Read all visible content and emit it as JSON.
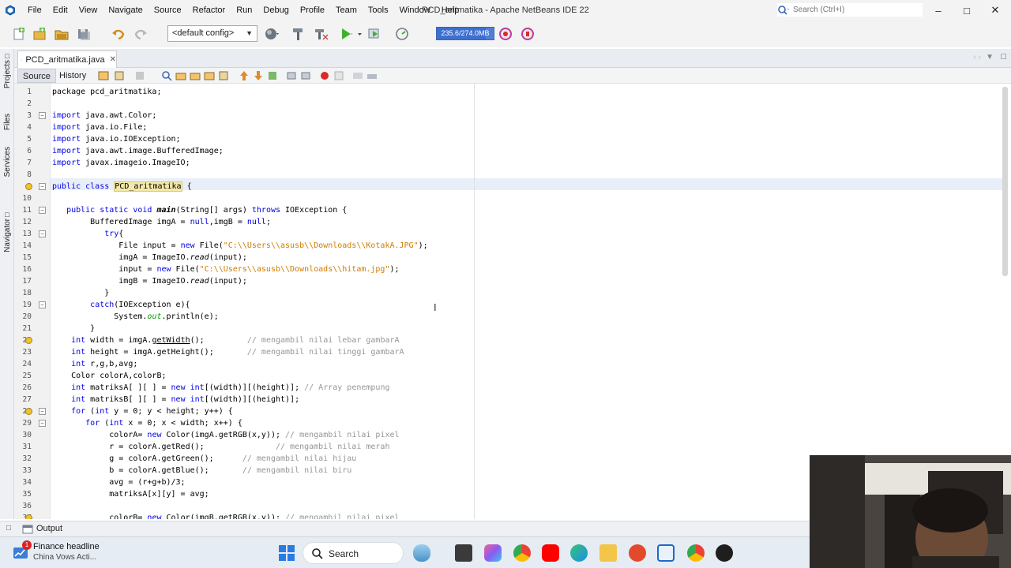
{
  "window": {
    "title": "PCD_aritmatika - Apache NetBeans IDE 22",
    "search_placeholder": "Search (Ctrl+I)"
  },
  "menu": [
    "File",
    "Edit",
    "View",
    "Navigate",
    "Source",
    "Refactor",
    "Run",
    "Debug",
    "Profile",
    "Team",
    "Tools",
    "Window",
    "Help"
  ],
  "toolbar": {
    "config": "<default config>",
    "memory_label": "235.6/274.0MB",
    "memory_fraction": 0.86
  },
  "sidebar": {
    "tabs": [
      "Projects",
      "Files",
      "Services",
      "Navigator"
    ]
  },
  "editor": {
    "file_tab": "PCD_aritmatika.java",
    "source_tab": "Source",
    "history_tab": "History"
  },
  "code_lines": [
    {
      "n": "1",
      "html": "package pcd_aritmatika;"
    },
    {
      "n": "2",
      "html": ""
    },
    {
      "n": "3",
      "html": "<span class='kw'>import</span> java.awt.Color;"
    },
    {
      "n": "4",
      "html": "<span class='kw'>import</span> java.io.File;"
    },
    {
      "n": "5",
      "html": "<span class='kw'>import</span> java.io.IOException;"
    },
    {
      "n": "6",
      "html": "<span class='kw'>import</span> java.awt.image.BufferedImage;"
    },
    {
      "n": "7",
      "html": "<span class='kw'>import</span> javax.imageio.ImageIO;"
    },
    {
      "n": "8",
      "html": ""
    },
    {
      "n": "9",
      "html": "<span class='kw'>public class</span> PCD_aritmatika {"
    },
    {
      "n": "10",
      "html": ""
    },
    {
      "n": "11",
      "html": "   <span class='kw'>public static void</span> <b class='ital'>main</b>(String[] args) <span class='kw'>throws</span> IOException {"
    },
    {
      "n": "12",
      "html": "        BufferedImage imgA = <span class='kw'>null</span>,imgB = <span class='kw'>null</span>;"
    },
    {
      "n": "13",
      "html": "           <span class='kw'>try</span>{"
    },
    {
      "n": "14",
      "html": "              File input = <span class='kw'>new</span> File(<span class='str'>\"C:\\\\Users\\\\asusb\\\\Downloads\\\\KotakA.JPG\"</span>);"
    },
    {
      "n": "15",
      "html": "              imgA = ImageIO.<span class='ital'>read</span>(input);"
    },
    {
      "n": "16",
      "html": "              input = <span class='kw'>new</span> File(<span class='str'>\"C:\\\\Users\\\\asusb\\\\Downloads\\\\hitam.jpg\"</span>);"
    },
    {
      "n": "17",
      "html": "              imgB = ImageIO.<span class='ital'>read</span>(input);"
    },
    {
      "n": "18",
      "html": "           }"
    },
    {
      "n": "19",
      "html": "        <span class='kw'>catch</span>(IOException e){"
    },
    {
      "n": "20",
      "html": "             System.<span class='fld ital'>out</span>.println(e);"
    },
    {
      "n": "21",
      "html": "        }"
    },
    {
      "n": "22",
      "html": "    <span class='kw'>int</span> width = imgA.<u>getWidth</u>();         <span class='cmt'>// mengambil nilai lebar gambarA</span>"
    },
    {
      "n": "23",
      "html": "    <span class='kw'>int</span> height = imgA.getHeight();       <span class='cmt'>// mengambil nilai tinggi gambarA</span>"
    },
    {
      "n": "24",
      "html": "    <span class='kw'>int</span> r,g,b,avg;"
    },
    {
      "n": "25",
      "html": "    Color colorA,colorB;"
    },
    {
      "n": "26",
      "html": "    <span class='kw'>int</span> matriksA[ ][ ] = <span class='kw'>new</span> <span class='kw'>int</span>[(width)][(height)]; <span class='cmt'>// Array penempung</span>"
    },
    {
      "n": "27",
      "html": "    <span class='kw'>int</span> matriksB[ ][ ] = <span class='kw'>new</span> <span class='kw'>int</span>[(width)][(height)];"
    },
    {
      "n": "28",
      "html": "    <span class='kw'>for</span> (<span class='kw'>int</span> y = 0; y &lt; height; y++) {"
    },
    {
      "n": "29",
      "html": "       <span class='kw'>for</span> (<span class='kw'>int</span> x = 0; x &lt; width; x++) {"
    },
    {
      "n": "30",
      "html": "            colorA= <span class='kw'>new</span> Color(imgA.getRGB(x,y)); <span class='cmt'>// mengambil nilai pixel</span>"
    },
    {
      "n": "31",
      "html": "            r = colorA.getRed();               <span class='cmt'>// mengambil nilai merah</span>"
    },
    {
      "n": "32",
      "html": "            g = colorA.getGreen();      <span class='cmt'>// mengambil nilai hijau</span>"
    },
    {
      "n": "33",
      "html": "            b = colorA.getBlue();       <span class='cmt'>// mengambil nilai biru</span>"
    },
    {
      "n": "34",
      "html": "            avg = (r+g+b)/3;"
    },
    {
      "n": "35",
      "html": "            matriksA[x][y] = avg;"
    },
    {
      "n": "36",
      "html": ""
    },
    {
      "n": "37",
      "html": "            colorB= <span class='kw'>new</span> Color(imgB.getRGB(x,y)); <span class='cmt'>// mengambil nilai pixel</span>"
    }
  ],
  "output": {
    "label": "Output"
  },
  "taskbar": {
    "news_headline": "Finance headline",
    "news_sub": "China Vows Acti...",
    "news_badge": "1",
    "search_label": "Search"
  },
  "colors": {
    "keyword": "#0000e6",
    "comment": "#969696",
    "string": "#ce7b00",
    "current_line": "#e9eff8",
    "memory_bar": "#4f7fd8"
  }
}
